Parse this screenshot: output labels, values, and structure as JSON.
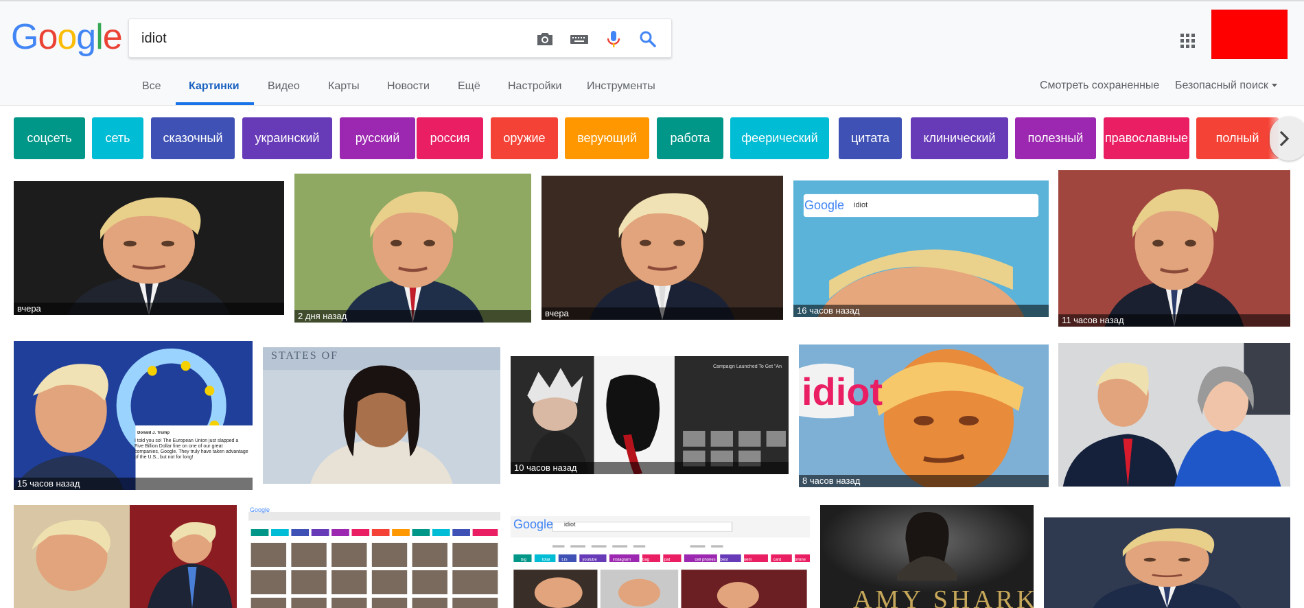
{
  "logo_text": "Google",
  "search": {
    "query": "idiot"
  },
  "icons": {
    "camera": "camera-icon",
    "keyboard": "keyboard-icon",
    "mic": "mic-icon",
    "search": "search-icon",
    "apps": "apps-grid-icon",
    "next": "chevron-right-icon"
  },
  "tabs": [
    {
      "label": "Все"
    },
    {
      "label": "Картинки"
    },
    {
      "label": "Видео"
    },
    {
      "label": "Карты"
    },
    {
      "label": "Новости"
    },
    {
      "label": "Ещё"
    },
    {
      "label": "Настройки"
    },
    {
      "label": "Инструменты"
    }
  ],
  "right_links": {
    "saved": "Смотреть сохраненные",
    "safe_search": "Безопасный поиск"
  },
  "chips": [
    {
      "label": "соцсеть",
      "color": "#009688"
    },
    {
      "label": "сеть",
      "color": "#00bcd4"
    },
    {
      "label": "сказочный",
      "color": "#3f51b5"
    },
    {
      "label": "украинский",
      "color": "#673ab7"
    },
    {
      "label": "русский",
      "color": "#9c27b0"
    },
    {
      "label": "россия",
      "color": "#e91e63"
    },
    {
      "label": "оружие",
      "color": "#f44336"
    },
    {
      "label": "верующий",
      "color": "#ff9800"
    },
    {
      "label": "работа",
      "color": "#009688"
    },
    {
      "label": "феерический",
      "color": "#00bcd4"
    },
    {
      "label": "цитата",
      "color": "#3f51b5"
    },
    {
      "label": "клинический",
      "color": "#673ab7"
    },
    {
      "label": "полезный",
      "color": "#9c27b0"
    },
    {
      "label": "православные",
      "color": "#e91e63"
    },
    {
      "label": "полный",
      "color": "#f44336"
    }
  ],
  "images": [
    {
      "caption": "вчера"
    },
    {
      "caption": "2 дня назад"
    },
    {
      "caption": "вчера"
    },
    {
      "caption": "16 часов назад",
      "inner_logo": "Google",
      "inner_query": "idiot"
    },
    {
      "caption": "11 часов назад"
    },
    {
      "caption": "15 часов назад",
      "tweet_author": "Donald J. Trump",
      "tweet_text": "I told you so! The European Union just slapped a Five Billion Dollar fine on one of our great companies, Google. They truly have taken advantage of the U.S., but not for long!"
    },
    {
      "caption": "",
      "sign_text": "STATES OF"
    },
    {
      "caption": "10 часов назад",
      "headline": "Campaign Launched To Get \"An"
    },
    {
      "caption": "8 часов назад",
      "word": "idiot"
    },
    {
      "caption": ""
    },
    {
      "caption": ""
    },
    {
      "caption": "",
      "inner_logo": "Google"
    },
    {
      "caption": "",
      "inner_logo": "Google",
      "inner_query": "idiot",
      "mini_chips": [
        "big",
        "total",
        "t.rs",
        "youtube",
        "instagram",
        "bag",
        "pat",
        "cell phones",
        "t.best",
        "poem",
        "card",
        "online"
      ]
    },
    {
      "caption": "",
      "poster_text": "AMY SHARK"
    },
    {
      "caption": ""
    }
  ]
}
